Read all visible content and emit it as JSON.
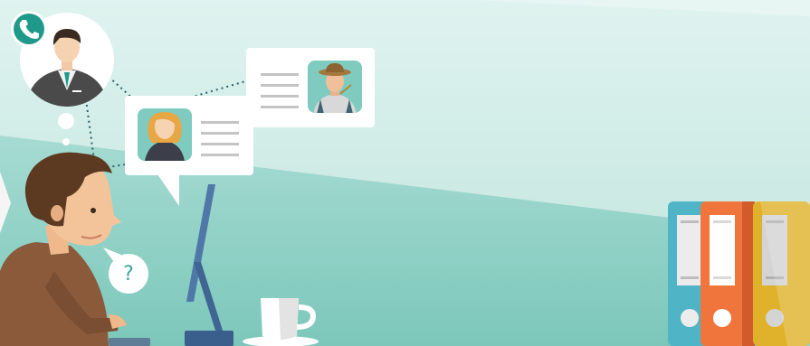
{
  "question_bubble": {
    "text": "?"
  },
  "colors": {
    "bg_light": "#d2ece8",
    "bg_teal": "#8fd0c6",
    "accent_teal": "#1f9a8a",
    "card_white": "#ffffff",
    "text_line": "#c4c4c4",
    "binder_blue": "#4fb4c6",
    "binder_orange": "#f0753d",
    "binder_gold": "#e0b22c",
    "monitor_blue": "#4f77a8"
  },
  "icons": [
    "phone-icon",
    "businessman-avatar",
    "woman-avatar",
    "farmer-avatar",
    "coffee-cup",
    "binder-blue",
    "binder-orange",
    "binder-gold"
  ]
}
